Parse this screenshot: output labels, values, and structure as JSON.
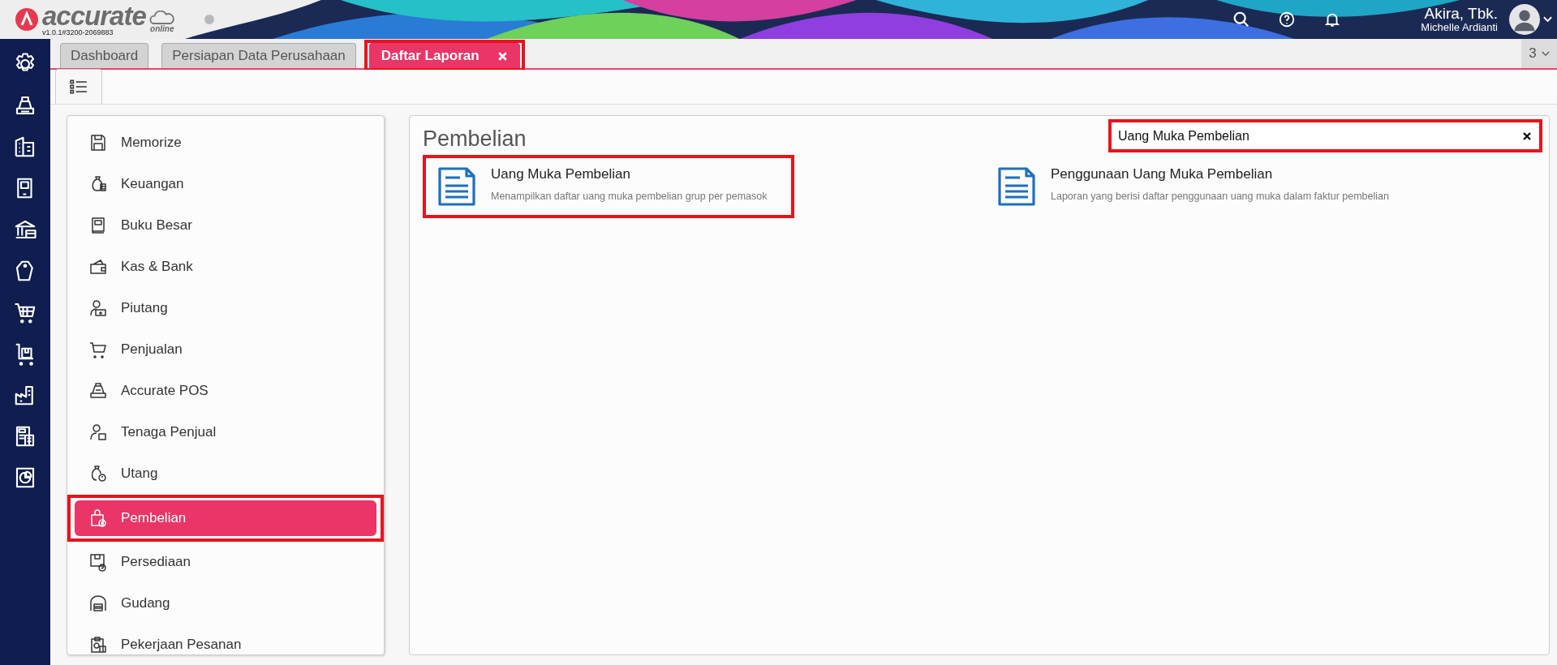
{
  "header": {
    "logo_text": "accurate",
    "logo_sub": "online",
    "app_version": "v1.0.1#3200-2069883",
    "company": "Akira, Tbk.",
    "user": "Michelle Ardianti"
  },
  "tabs": [
    {
      "label": "Dashboard",
      "selected": false,
      "closable": false,
      "highlighted": false
    },
    {
      "label": "Persiapan Data Perusahaan",
      "selected": false,
      "closable": false,
      "highlighted": false
    },
    {
      "label": "Daftar Laporan",
      "selected": true,
      "closable": true,
      "highlighted": true
    }
  ],
  "tab_count": "3",
  "categories": [
    {
      "label": "Memorize",
      "selected": false,
      "highlighted": false
    },
    {
      "label": "Keuangan",
      "selected": false,
      "highlighted": false
    },
    {
      "label": "Buku Besar",
      "selected": false,
      "highlighted": false
    },
    {
      "label": "Kas & Bank",
      "selected": false,
      "highlighted": false
    },
    {
      "label": "Piutang",
      "selected": false,
      "highlighted": false
    },
    {
      "label": "Penjualan",
      "selected": false,
      "highlighted": false
    },
    {
      "label": "Accurate POS",
      "selected": false,
      "highlighted": false
    },
    {
      "label": "Tenaga Penjual",
      "selected": false,
      "highlighted": false
    },
    {
      "label": "Utang",
      "selected": false,
      "highlighted": false
    },
    {
      "label": "Pembelian",
      "selected": true,
      "highlighted": true
    },
    {
      "label": "Persediaan",
      "selected": false,
      "highlighted": false
    },
    {
      "label": "Gudang",
      "selected": false,
      "highlighted": false
    },
    {
      "label": "Pekerjaan Pesanan",
      "selected": false,
      "highlighted": false
    }
  ],
  "section_title": "Pembelian",
  "search": {
    "value": "Uang Muka Pembelian",
    "highlighted": true
  },
  "reports": [
    {
      "title": "Uang Muka Pembelian",
      "description": "Menampilkan daftar uang muka pembelian grup per pemasok",
      "highlighted": true
    },
    {
      "title": "Penggunaan Uang Muka Pembelian",
      "description": "Laporan yang berisi daftar penggunaan uang muka dalam faktur pembelian",
      "highlighted": false
    }
  ]
}
